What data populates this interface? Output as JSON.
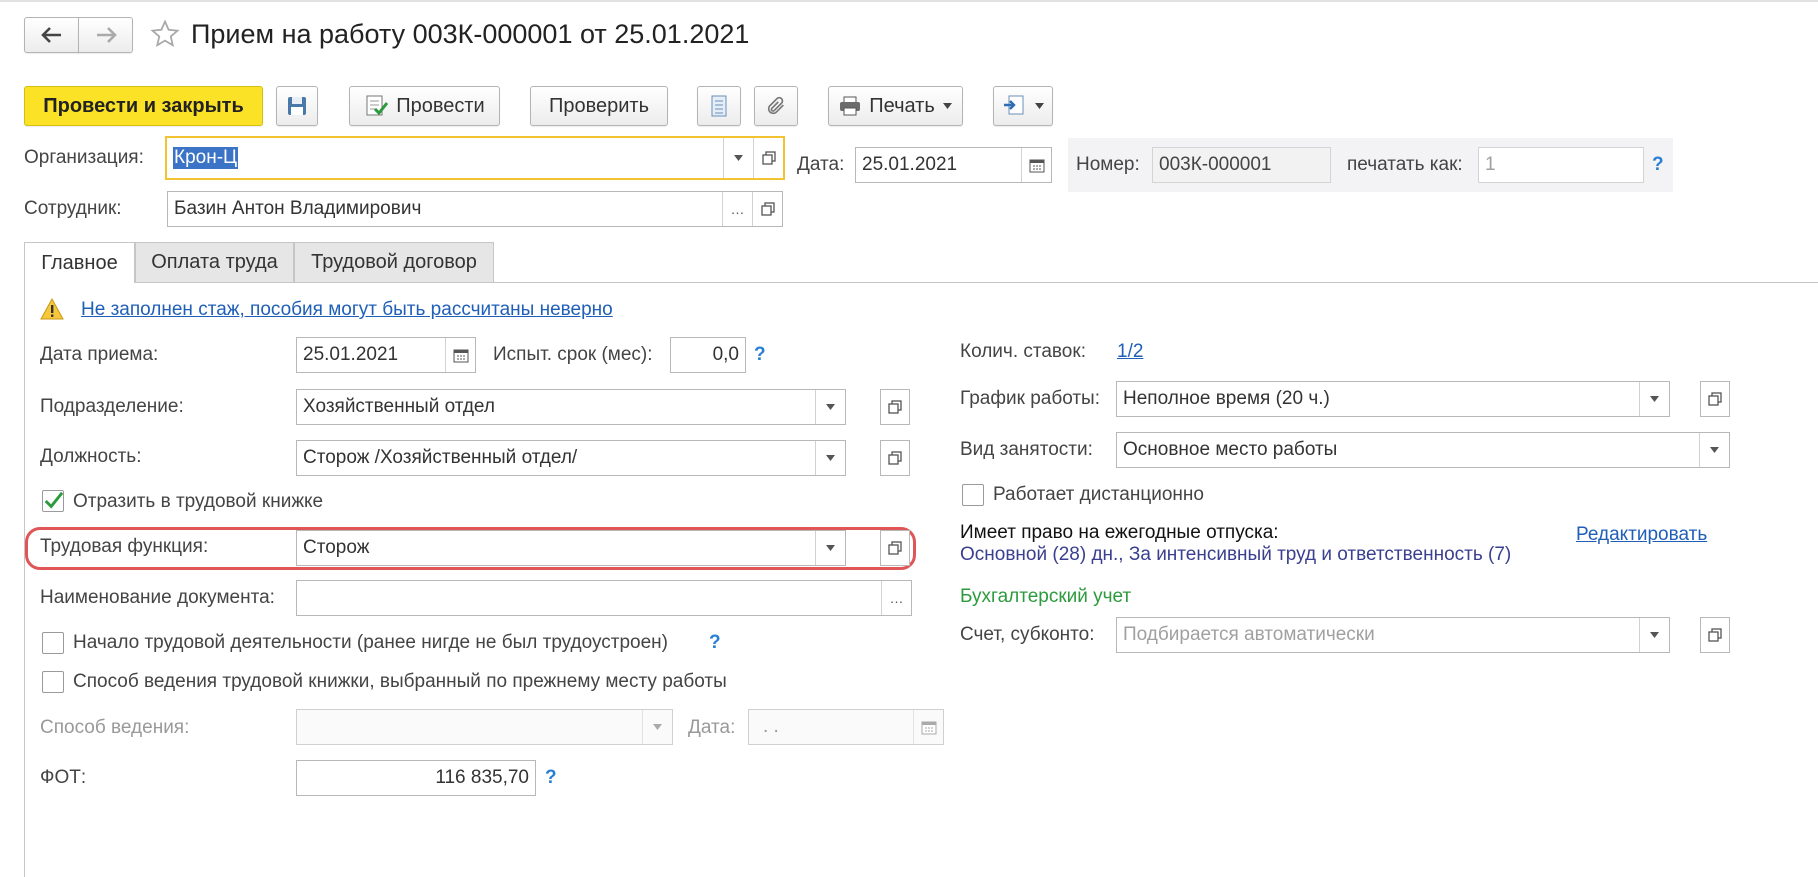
{
  "window": {
    "title": "Прием на работу 003К-000001 от 25.01.2021"
  },
  "toolbar": {
    "post_close": "Провести и закрыть",
    "post": "Провести",
    "check": "Проверить",
    "print": "Печать"
  },
  "header": {
    "org_label": "Организация:",
    "org_value": "Крон-Ц",
    "date_label": "Дата:",
    "date_value": "25.01.2021",
    "number_label": "Номер:",
    "number_value": "003К-000001",
    "print_as_label": "печатать как:",
    "print_as_value": "1",
    "employee_label": "Сотрудник:",
    "employee_value": "Базин Антон Владимирович"
  },
  "tabs": [
    {
      "label": "Главное",
      "active": true
    },
    {
      "label": "Оплата труда",
      "active": false
    },
    {
      "label": "Трудовой договор",
      "active": false
    }
  ],
  "warning": "Не заполнен стаж, пособия могут быть рассчитаны неверно",
  "left": {
    "hire_date_label": "Дата приема:",
    "hire_date_value": "25.01.2021",
    "trial_label": "Испыт. срок (мес):",
    "trial_value": "0,0",
    "department_label": "Подразделение:",
    "department_value": "Хозяйственный отдел",
    "position_label": "Должность:",
    "position_value": "Сторож /Хозяйственный отдел/",
    "workbook_label": "Отразить в трудовой книжке",
    "workbook_checked": true,
    "labor_function_label": "Трудовая функция:",
    "labor_function_value": "Сторож",
    "doc_name_label": "Наименование документа:",
    "doc_name_value": "",
    "first_job_label": "Начало трудовой деятельности (ранее нигде не был трудоустроен)",
    "prev_method_label": "Способ ведения трудовой книжки, выбранный по прежнему месту работы",
    "method_label": "Способ ведения:",
    "method_date_label": "Дата:",
    "method_date_value": " .  .",
    "fot_label": "ФОТ:",
    "fot_value": "116 835,70"
  },
  "right": {
    "rates_label": "Колич. ставок:",
    "rates_value": "1/2",
    "schedule_label": "График работы:",
    "schedule_value": "Неполное время (20 ч.)",
    "employment_label": "Вид занятости:",
    "employment_value": "Основное место работы",
    "remote_label": "Работает дистанционно",
    "vacation_label": "Имеет право на ежегодные отпуска:",
    "vacation_edit": "Редактировать",
    "vacation_value": "Основной (28) дн., За интенсивный труд и ответственность (7)",
    "accounting_title": "Бухгалтерский учет",
    "account_label": "Счет, субконто:",
    "account_placeholder": "Подбирается автоматически"
  },
  "colors": {
    "primary_button": "#fbe227",
    "highlight_outline": "#e05555",
    "focus_border": "#f2c230",
    "link": "#1f5fb8",
    "section_green": "#2e9a3e",
    "check_green": "#2e9a3e"
  }
}
